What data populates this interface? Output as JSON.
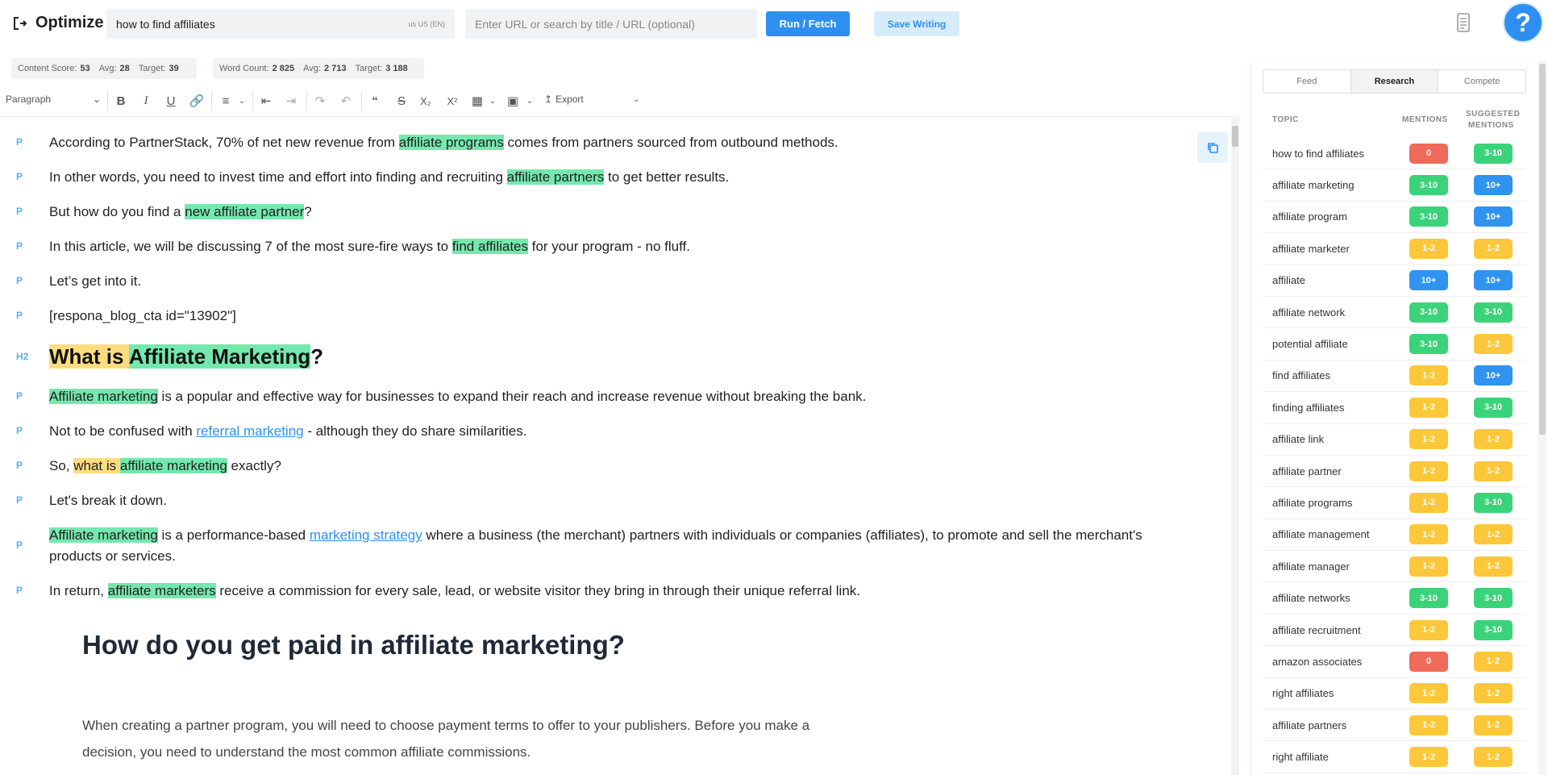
{
  "header": {
    "brand": "Optimize",
    "keyword": "how to find affiliates",
    "locale": "US (EN)",
    "url_placeholder": "Enter URL or search by title / URL (optional)",
    "run_label": "Run / Fetch",
    "save_label": "Save Writing",
    "help_label": "?"
  },
  "stats": {
    "content_score_label": "Content Score:",
    "content_score": "53",
    "avg_label": "Avg:",
    "content_avg": "28",
    "target_label": "Target:",
    "content_target": "39",
    "word_count_label": "Word Count:",
    "word_count": "2 825",
    "word_avg": "2 713",
    "word_target": "3 188"
  },
  "toolbar": {
    "paragraph_select": "Paragraph",
    "export_label": "Export"
  },
  "editor": {
    "blocks": [
      {
        "tag": "P",
        "pre": "According to PartnerStack, 70% of net new revenue from ",
        "hl": "affiliate programs",
        "post": " comes from partners sourced from outbound methods."
      },
      {
        "tag": "P",
        "pre": "In other words, you need to invest time and effort into finding and recruiting ",
        "hl": "affiliate partners",
        "post": " to get better results."
      },
      {
        "tag": "P",
        "pre": "But how do you find a ",
        "hl": "new affiliate partner",
        "post": "?"
      },
      {
        "tag": "P",
        "pre": "In this article, we will be discussing 7 of the most sure-fire ways to ",
        "hl": "find affiliates",
        "post": " for your program - no fluff."
      },
      {
        "tag": "P",
        "text": "Let’s get into it."
      },
      {
        "tag": "P",
        "text": "[respona_blog_cta id=\"13902\"]"
      },
      {
        "tag": "H2",
        "y": "What is ",
        "g": "Affiliate Marketing",
        "post": "?"
      },
      {
        "tag": "P",
        "hl": "Affiliate marketing",
        "post": " is a popular and effective way for businesses to expand their reach and increase revenue without breaking the bank."
      },
      {
        "tag": "P",
        "pre": "Not to be confused with ",
        "link": "referral marketing",
        "post": " - although they do share similarities."
      },
      {
        "tag": "P",
        "pre": "So, ",
        "y": "what is ",
        "g": "affiliate marketing",
        "post": " exactly?"
      },
      {
        "tag": "P",
        "text": "Let's break it down."
      },
      {
        "tag": "P",
        "hl": "Affiliate marketing",
        "mid": " is a performance-based ",
        "link": "marketing strategy",
        "post": " where a business (the merchant) partners with individuals or companies (affiliates), to promote and sell the merchant's products or services."
      },
      {
        "tag": "P",
        "pre": "In return, ",
        "hl": "affiliate marketers",
        "post": " receive a commission for every sale, lead, or website visitor they bring in through their unique referral link."
      }
    ],
    "image_title": "How do you get paid in affiliate marketing?",
    "image_text": "When creating a partner program, you will need to choose payment terms to offer to your publishers. Before you make a decision, you need to understand the most common affiliate commissions."
  },
  "panel": {
    "tabs": [
      "Feed",
      "Research",
      "Compete"
    ],
    "headers": {
      "topic": "TOPIC",
      "mentions": "MENTIONS",
      "suggested_1": "SUGGESTED",
      "suggested_2": "MENTIONS"
    },
    "colors": {
      "red": "#ef6a5a",
      "green": "#3bd37a",
      "blue": "#2f93f0",
      "yellow": "#fcc73a"
    },
    "rows": [
      {
        "topic": "how to find affiliates",
        "m": "0",
        "mc": "red",
        "s": "3-10",
        "sc": "green"
      },
      {
        "topic": "affiliate marketing",
        "m": "3-10",
        "mc": "green",
        "s": "10+",
        "sc": "blue"
      },
      {
        "topic": "affiliate program",
        "m": "3-10",
        "mc": "green",
        "s": "10+",
        "sc": "blue"
      },
      {
        "topic": "affiliate marketer",
        "m": "1-2",
        "mc": "yellow",
        "s": "1-2",
        "sc": "yellow"
      },
      {
        "topic": "affiliate",
        "m": "10+",
        "mc": "blue",
        "s": "10+",
        "sc": "blue"
      },
      {
        "topic": "affiliate network",
        "m": "3-10",
        "mc": "green",
        "s": "3-10",
        "sc": "green"
      },
      {
        "topic": "potential affiliate",
        "m": "3-10",
        "mc": "green",
        "s": "1-2",
        "sc": "yellow"
      },
      {
        "topic": "find affiliates",
        "m": "1-2",
        "mc": "yellow",
        "s": "10+",
        "sc": "blue"
      },
      {
        "topic": "finding affiliates",
        "m": "1-2",
        "mc": "yellow",
        "s": "3-10",
        "sc": "green"
      },
      {
        "topic": "affiliate link",
        "m": "1-2",
        "mc": "yellow",
        "s": "1-2",
        "sc": "yellow"
      },
      {
        "topic": "affiliate partner",
        "m": "1-2",
        "mc": "yellow",
        "s": "1-2",
        "sc": "yellow"
      },
      {
        "topic": "affiliate programs",
        "m": "1-2",
        "mc": "yellow",
        "s": "3-10",
        "sc": "green"
      },
      {
        "topic": "affiliate management",
        "m": "1-2",
        "mc": "yellow",
        "s": "1-2",
        "sc": "yellow"
      },
      {
        "topic": "affiliate manager",
        "m": "1-2",
        "mc": "yellow",
        "s": "1-2",
        "sc": "yellow"
      },
      {
        "topic": "affiliate networks",
        "m": "3-10",
        "mc": "green",
        "s": "3-10",
        "sc": "green"
      },
      {
        "topic": "affiliate recruitment",
        "m": "1-2",
        "mc": "yellow",
        "s": "3-10",
        "sc": "green"
      },
      {
        "topic": "amazon associates",
        "m": "0",
        "mc": "red",
        "s": "1-2",
        "sc": "yellow"
      },
      {
        "topic": "right affiliates",
        "m": "1-2",
        "mc": "yellow",
        "s": "1-2",
        "sc": "yellow"
      },
      {
        "topic": "affiliate partners",
        "m": "1-2",
        "mc": "yellow",
        "s": "1-2",
        "sc": "yellow"
      },
      {
        "topic": "right affiliate",
        "m": "1-2",
        "mc": "yellow",
        "s": "1-2",
        "sc": "yellow"
      }
    ]
  }
}
